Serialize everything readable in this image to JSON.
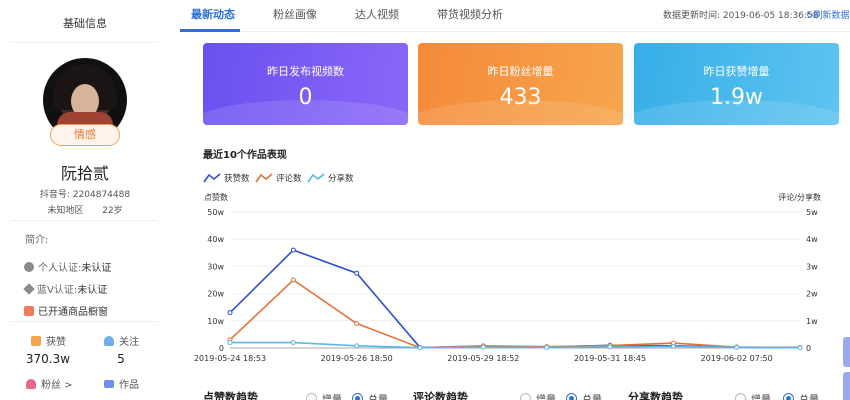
{
  "sidebar": {
    "title": "基础信息",
    "tag": "情感",
    "name": "阮拾贰",
    "douyin_id": "抖音号: 2204874488",
    "region": "未知地区",
    "age": "22岁",
    "intro_label": "简介:",
    "cert_personal_label": "个人认证:",
    "cert_personal_value": "未认证",
    "cert_blue_label": "蓝V认证:",
    "cert_blue_value": "未认证",
    "shop_text": "已开通商品橱窗",
    "stats": {
      "likes_label": "获赞",
      "likes_value": "370.3w",
      "following_label": "关注",
      "following_value": "5",
      "fans_label": "粉丝 >",
      "works_label": "作品"
    }
  },
  "tabs": [
    "最新动态",
    "粉丝画像",
    "达人视频",
    "带货视频分析"
  ],
  "updated_text": "数据更新时间: 2019-06-05 18:36:58",
  "refresh_label": "刷新数据",
  "cards": [
    {
      "label": "昨日发布视频数",
      "value": "0"
    },
    {
      "label": "昨日粉丝增量",
      "value": "433"
    },
    {
      "label": "昨日获赞增量",
      "value": "1.9w"
    }
  ],
  "section_title": "最近10个作品表现",
  "colors": {
    "likes": "#2f4fd0",
    "comments": "#e0733a",
    "shares": "#5ab8e8",
    "accent": "#2f6fd8"
  },
  "chart_data": {
    "type": "line",
    "legend": [
      "获赞数",
      "评论数",
      "分享数"
    ],
    "ylabel_left": "点赞数",
    "ylabel_right": "评论/分享数",
    "yticks_left": [
      "0",
      "10w",
      "20w",
      "30w",
      "40w",
      "50w"
    ],
    "yticks_right": [
      "0",
      "1w",
      "2w",
      "3w",
      "4w",
      "5w"
    ],
    "xtick_labels": [
      "2019-05-24 18:53",
      "2019-05-26 18:50",
      "2019-05-29 18:52",
      "2019-05-31 18:45",
      "2019-06-02 07:50"
    ],
    "ylim": [
      0,
      500000
    ],
    "series": [
      {
        "name": "获赞数",
        "values": [
          130000,
          360000,
          275000,
          2000,
          5000,
          3000,
          10000,
          8000,
          3000,
          2000
        ]
      },
      {
        "name": "评论数",
        "values": [
          3000,
          25000,
          9000,
          100,
          800,
          500,
          900,
          1800,
          300,
          200
        ]
      },
      {
        "name": "分享数",
        "values": [
          2000,
          2000,
          800,
          100,
          300,
          200,
          400,
          600,
          200,
          100
        ]
      }
    ]
  },
  "bottom": {
    "likes_trend": "点赞数趋势",
    "comment_trend": "评论数趋势",
    "share_trend": "分享数趋势",
    "inc_label": "增量",
    "total_label": "总量"
  }
}
